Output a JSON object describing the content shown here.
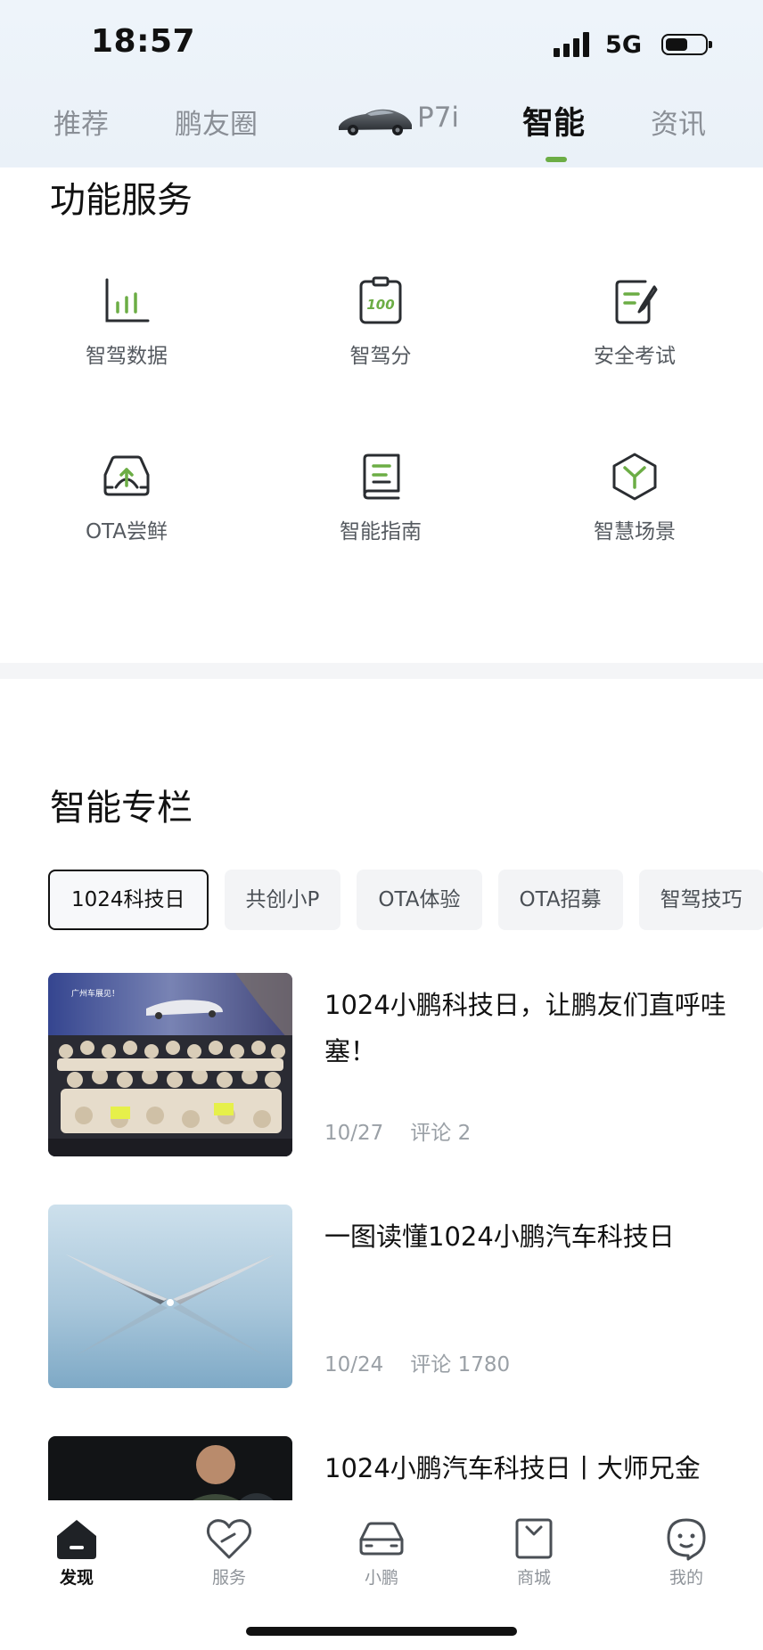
{
  "status_bar": {
    "time": "18:57",
    "network": "5G"
  },
  "top_nav": {
    "tabs": [
      "推荐",
      "鹏友圈",
      "P7i",
      "智能",
      "资讯"
    ],
    "active": "智能"
  },
  "function_services": {
    "title": "功能服务",
    "items": [
      {
        "label": "智驾数据",
        "icon": "bar-chart-icon"
      },
      {
        "label": "智驾分",
        "icon": "score-clipboard-icon",
        "icon_text": "100"
      },
      {
        "label": "安全考试",
        "icon": "exam-edit-icon"
      },
      {
        "label": "OTA尝鲜",
        "icon": "car-upgrade-icon"
      },
      {
        "label": "智能指南",
        "icon": "guide-book-icon"
      },
      {
        "label": "智慧场景",
        "icon": "scene-cube-icon"
      }
    ]
  },
  "smart_column": {
    "title": "智能专栏",
    "chips": [
      "1024科技日",
      "共创小P",
      "OTA体验",
      "OTA招募",
      "智驾技巧"
    ],
    "active_chip": "1024科技日"
  },
  "articles": [
    {
      "title": "1024小鹏科技日，让鹏友们直呼哇塞！",
      "date": "10/27",
      "comments": "评论 2",
      "thumb_text": "广州车展见！"
    },
    {
      "title": "一图读懂1024小鹏汽车科技日",
      "date": "10/24",
      "comments": "评论 1780"
    },
    {
      "title": "1024小鹏汽车科技日丨大师兄金"
    }
  ],
  "bottom_nav": {
    "items": [
      {
        "label": "发现",
        "icon": "home-icon"
      },
      {
        "label": "服务",
        "icon": "heart-service-icon"
      },
      {
        "label": "小鹏",
        "icon": "car-icon"
      },
      {
        "label": "商城",
        "icon": "shopping-bag-icon"
      },
      {
        "label": "我的",
        "icon": "profile-face-icon"
      }
    ],
    "active": "发现"
  },
  "colors": {
    "accent": "#6cad45",
    "text": "#111111",
    "muted": "#8a8f96"
  }
}
